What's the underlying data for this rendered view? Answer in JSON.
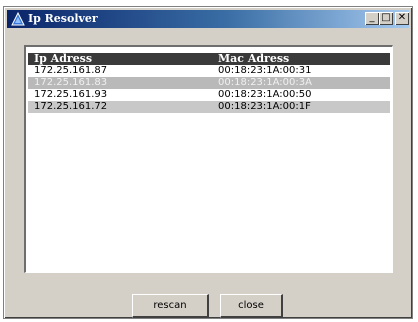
{
  "window": {
    "title": "Ip Resolver",
    "minimize_glyph": "_",
    "maximize_glyph": "□",
    "close_glyph": "✕"
  },
  "table": {
    "columns": [
      "Ip Adress",
      "Mac Adress"
    ],
    "rows": [
      {
        "ip": "172.25.161.87",
        "mac": "00:18:23:1A:00:31"
      },
      {
        "ip": "172.25.161.83",
        "mac": "00:18:23:1A:00:3A"
      },
      {
        "ip": "172.25.161.93",
        "mac": "00:18:23:1A:00:50"
      },
      {
        "ip": "172.25.161.72",
        "mac": "00:18:23:1A:00:1F"
      }
    ]
  },
  "buttons": {
    "rescan": "rescan",
    "close": "close"
  },
  "colors": {
    "title_gradient_start": "#0a246a",
    "title_gradient_end": "#a6caf0",
    "header_bg": "#3a3a3a",
    "row_alt_bg": "#c8c8c8",
    "window_bg": "#d4d0c8"
  }
}
